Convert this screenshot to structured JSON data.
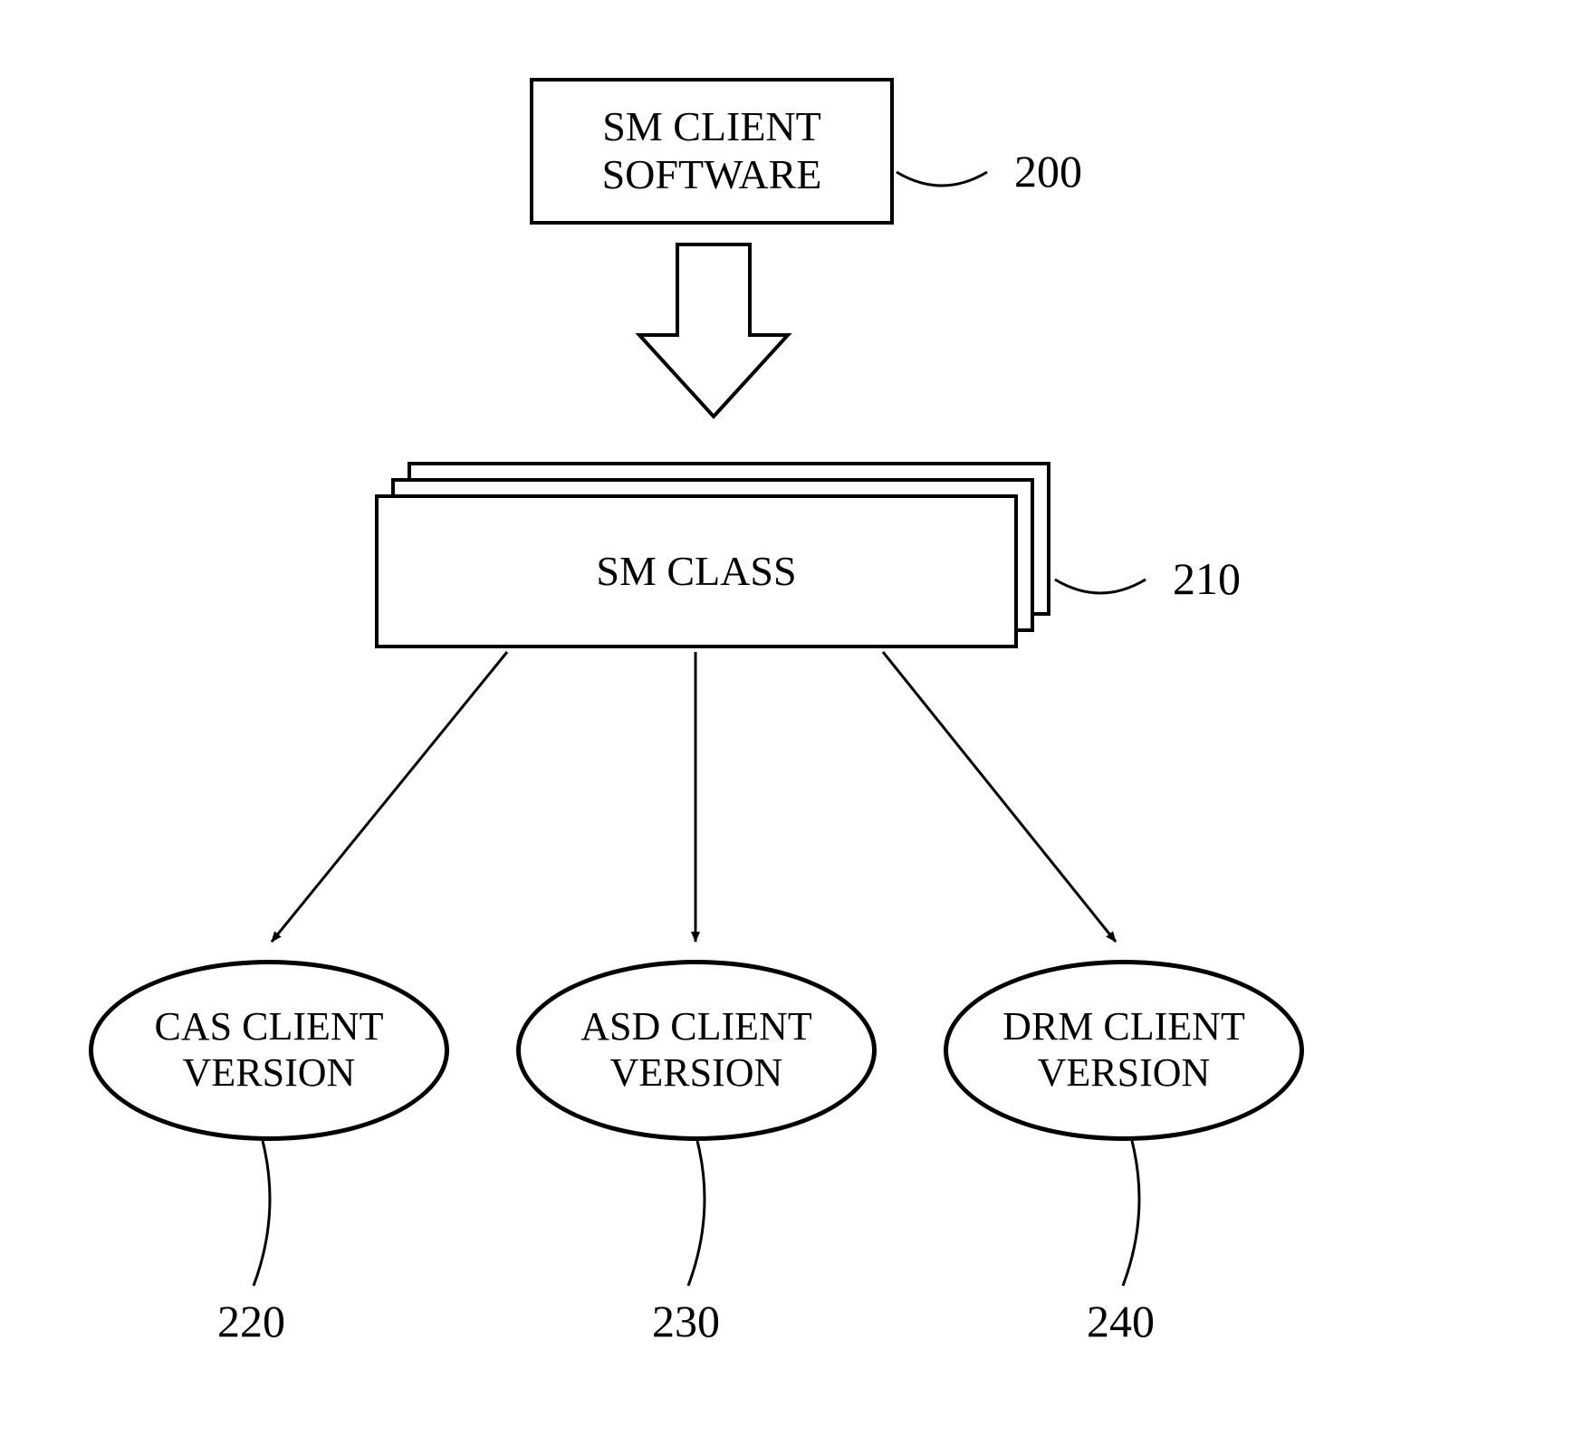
{
  "nodes": {
    "sm_client_software": {
      "label": "SM CLIENT\nSOFTWARE",
      "ref": "200"
    },
    "sm_class": {
      "label": "SM CLASS",
      "ref": "210"
    },
    "cas": {
      "label": "CAS CLIENT\nVERSION",
      "ref": "220"
    },
    "asd": {
      "label": "ASD CLIENT\nVERSION",
      "ref": "230"
    },
    "drm": {
      "label": "DRM CLIENT\nVERSION",
      "ref": "240"
    }
  },
  "chart_data": {
    "type": "diagram",
    "nodes": [
      {
        "id": "200",
        "label": "SM CLIENT SOFTWARE",
        "shape": "rect"
      },
      {
        "id": "210",
        "label": "SM CLASS",
        "shape": "rect-stack"
      },
      {
        "id": "220",
        "label": "CAS CLIENT VERSION",
        "shape": "ellipse"
      },
      {
        "id": "230",
        "label": "ASD CLIENT VERSION",
        "shape": "ellipse"
      },
      {
        "id": "240",
        "label": "DRM CLIENT VERSION",
        "shape": "ellipse"
      }
    ],
    "edges": [
      {
        "from": "200",
        "to": "210",
        "style": "block-arrow"
      },
      {
        "from": "210",
        "to": "220",
        "style": "thin-arrow"
      },
      {
        "from": "210",
        "to": "230",
        "style": "thin-arrow"
      },
      {
        "from": "210",
        "to": "240",
        "style": "thin-arrow"
      }
    ]
  }
}
